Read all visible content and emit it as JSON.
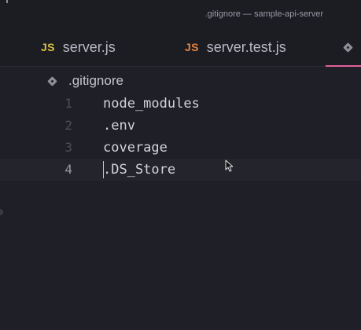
{
  "window": {
    "title": ".gitignore — sample-api-server"
  },
  "tabs": [
    {
      "badge": "JS",
      "label": "server.js",
      "icon": "javascript-file-icon"
    },
    {
      "badge": "JS",
      "label": "server.test.js",
      "icon": "javascript-file-icon"
    },
    {
      "icon": "git-file-icon",
      "active": true
    }
  ],
  "colors": {
    "background": "#1f1f27",
    "js_badge_yellow": "#d8c242",
    "js_badge_orange": "#e3823f",
    "active_tab_underline": "#e0609a"
  },
  "breadcrumb": {
    "icon": "git-file-icon",
    "label": ".gitignore"
  },
  "editor": {
    "current_line": 4,
    "lines": [
      {
        "number": "1",
        "text": "node_modules"
      },
      {
        "number": "2",
        "text": ".env"
      },
      {
        "number": "3",
        "text": "coverage"
      },
      {
        "number": "4",
        "text": ".DS_Store"
      }
    ]
  }
}
